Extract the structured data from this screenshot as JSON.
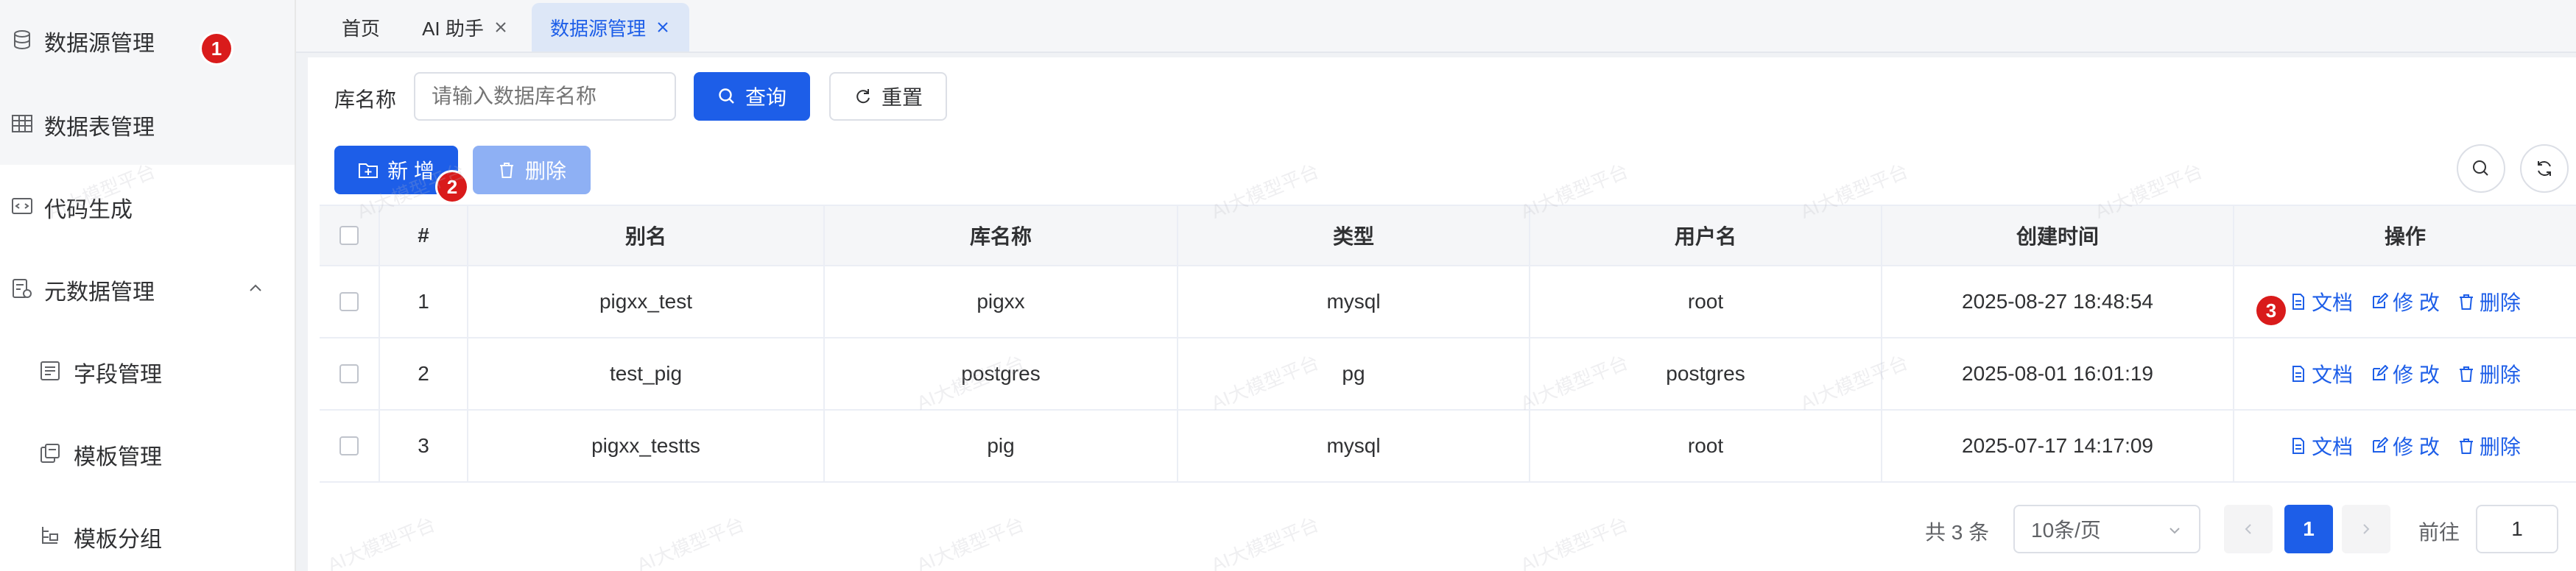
{
  "sidebar": {
    "items": [
      {
        "label": "数据源管理",
        "icon": "database-icon"
      },
      {
        "label": "数据表管理",
        "icon": "table-grid-icon"
      },
      {
        "label": "代码生成",
        "icon": "code-icon"
      },
      {
        "label": "元数据管理",
        "icon": "metadata-icon"
      },
      {
        "label": "字段管理",
        "icon": "field-list-icon"
      },
      {
        "label": "模板管理",
        "icon": "template-icon"
      },
      {
        "label": "模板分组",
        "icon": "template-group-icon"
      }
    ]
  },
  "markers": [
    "1",
    "2",
    "3"
  ],
  "tabs": [
    {
      "label": "首页",
      "closable": false
    },
    {
      "label": "AI 助手",
      "closable": true
    },
    {
      "label": "数据源管理",
      "closable": true,
      "active": true
    }
  ],
  "search": {
    "label": "库名称",
    "placeholder": "请输入数据库名称",
    "query_label": "查询",
    "reset_label": "重置"
  },
  "toolbar": {
    "add_label": "新 增",
    "delete_label": "删除"
  },
  "table": {
    "columns": [
      "#",
      "别名",
      "库名称",
      "类型",
      "用户名",
      "创建时间",
      "操作"
    ],
    "rows": [
      {
        "index": "1",
        "alias": "pigxx_test",
        "db": "pigxx",
        "type": "mysql",
        "user": "root",
        "created": "2025-08-27 18:48:54"
      },
      {
        "index": "2",
        "alias": "test_pig",
        "db": "postgres",
        "type": "pg",
        "user": "postgres",
        "created": "2025-08-01 16:01:19"
      },
      {
        "index": "3",
        "alias": "pigxx_testts",
        "db": "pig",
        "type": "mysql",
        "user": "root",
        "created": "2025-07-17 14:17:09"
      }
    ],
    "actions": {
      "doc": "文档",
      "edit": "修 改",
      "delete": "删除"
    }
  },
  "pagination": {
    "total": "共 3 条",
    "page_size": "10条/页",
    "current_page": "1",
    "goto_label": "前往",
    "goto_value": "1"
  },
  "watermark": "AI大模型平台",
  "colors": {
    "primary": "#1d5ee8",
    "marker": "#d91b1b"
  }
}
